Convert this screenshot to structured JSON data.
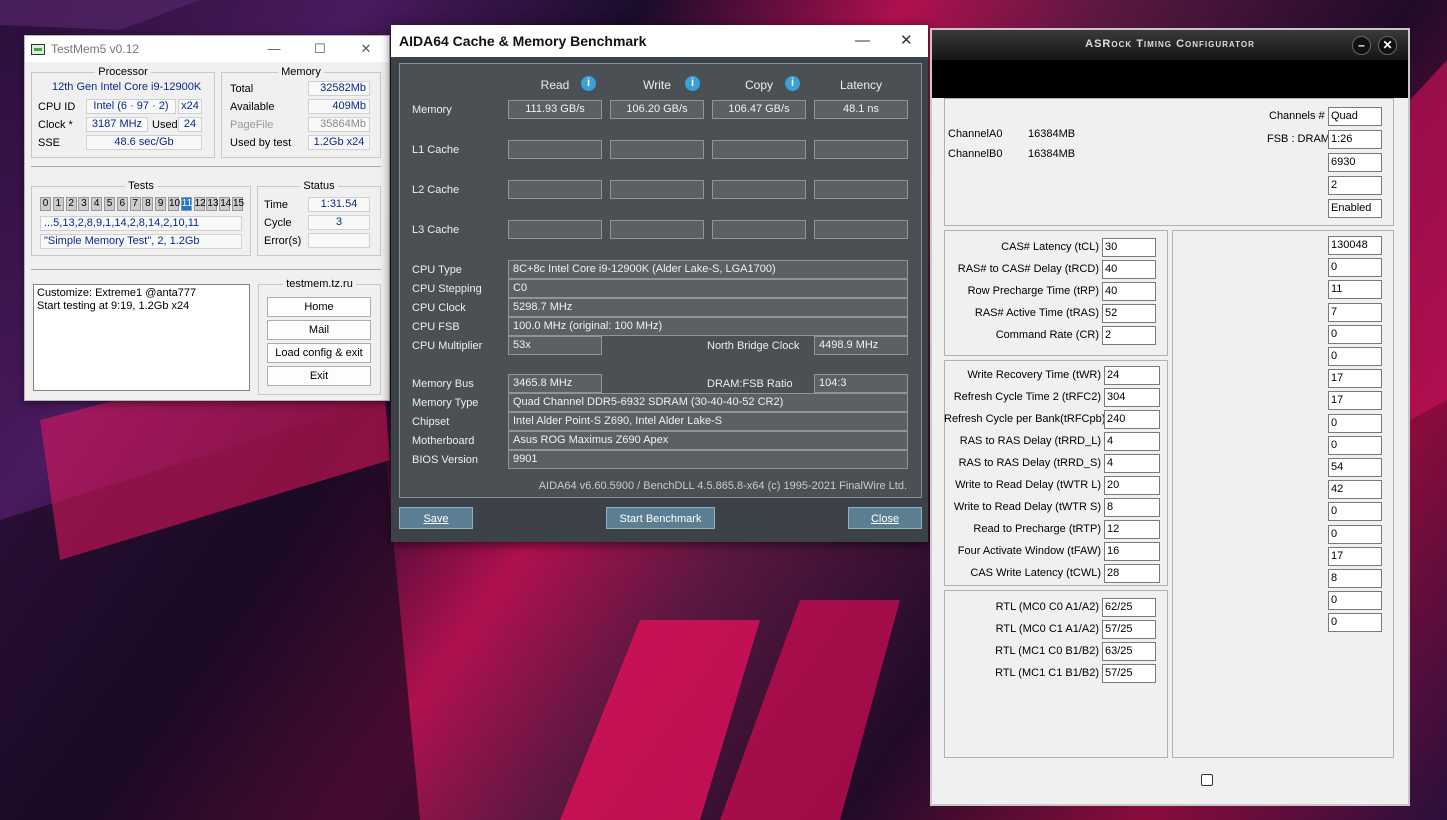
{
  "testmem": {
    "title": "TestMem5 v0.12",
    "processor": {
      "heading": "Processor",
      "name": "12th Gen Intel Core i9-12900K",
      "cpuid_label": "CPU ID",
      "cpuid_value": "Intel  (6 · 97 · 2)",
      "threads": "x24",
      "clock_label": "Clock *",
      "clock_value": "3187 MHz",
      "used_label": "Used",
      "used_value": "24",
      "sse_label": "SSE",
      "sse_value": "48.6 sec/Gb"
    },
    "memory": {
      "heading": "Memory",
      "total_label": "Total",
      "total_value": "32582Mb",
      "available_label": "Available",
      "available_value": "409Mb",
      "pagefile_label": "PageFile",
      "pagefile_value": "35864Mb",
      "usedby_label": "Used by test",
      "usedby_value": "1.2Gb x24"
    },
    "tests": {
      "heading": "Tests",
      "numbers": [
        "0",
        "1",
        "2",
        "3",
        "4",
        "5",
        "6",
        "7",
        "8",
        "9",
        "10",
        "11",
        "12",
        "13",
        "14",
        "15"
      ],
      "active": "11",
      "sequence": "...5,13,2,8,9,1,14,2,8,14,2,10,11",
      "current": "\"Simple Memory Test\", 2, 1.2Gb"
    },
    "status": {
      "heading": "Status",
      "time_label": "Time",
      "time_value": "1:31.54",
      "cycle_label": "Cycle",
      "cycle_value": "3",
      "errors_label": "Error(s)",
      "errors_value": ""
    },
    "log": {
      "line1": "Customize: Extreme1 @anta777",
      "line2": "Start testing at 9:19, 1.2Gb x24"
    },
    "site": {
      "heading": "testmem.tz.ru",
      "home": "Home",
      "mail": "Mail",
      "load": "Load config & exit",
      "exit": "Exit"
    }
  },
  "aida": {
    "title": "AIDA64 Cache & Memory Benchmark",
    "headers": {
      "read": "Read",
      "write": "Write",
      "copy": "Copy",
      "latency": "Latency"
    },
    "rows": {
      "memory": {
        "label": "Memory",
        "read": "111.93 GB/s",
        "write": "106.20 GB/s",
        "copy": "106.47 GB/s",
        "latency": "48.1 ns"
      },
      "l1": {
        "label": "L1 Cache"
      },
      "l2": {
        "label": "L2 Cache"
      },
      "l3": {
        "label": "L3 Cache"
      }
    },
    "info": {
      "cpu_type_label": "CPU Type",
      "cpu_type": "8C+8c Intel Core i9-12900K  (Alder Lake-S, LGA1700)",
      "cpu_stepping_label": "CPU Stepping",
      "cpu_stepping": "C0",
      "cpu_clock_label": "CPU Clock",
      "cpu_clock": "5298.7 MHz",
      "cpu_fsb_label": "CPU FSB",
      "cpu_fsb": "100.0 MHz  (original: 100 MHz)",
      "cpu_mult_label": "CPU Multiplier",
      "cpu_mult": "53x",
      "nb_clock_label": "North Bridge Clock",
      "nb_clock": "4498.9 MHz",
      "mem_bus_label": "Memory Bus",
      "mem_bus": "3465.8 MHz",
      "dram_fsb_label": "DRAM:FSB Ratio",
      "dram_fsb": "104:3",
      "mem_type_label": "Memory Type",
      "mem_type": "Quad Channel DDR5-6932 SDRAM  (30-40-40-52 CR2)",
      "chipset_label": "Chipset",
      "chipset": "Intel Alder Point-S Z690, Intel Alder Lake-S",
      "mobo_label": "Motherboard",
      "mobo": "Asus ROG Maximus Z690 Apex",
      "bios_label": "BIOS Version",
      "bios": "9901"
    },
    "footer": "AIDA64 v6.60.5900 / BenchDLL 4.5.865.8-x64  (c) 1995-2021 FinalWire Ltd.",
    "buttons": {
      "save": "Save",
      "start": "Start Benchmark",
      "close": "Close"
    }
  },
  "asrock": {
    "title": "ASRock Timing Configurator",
    "channels": [
      {
        "name": "ChannelA0",
        "size": "16384MB"
      },
      {
        "name": "ChannelB0",
        "size": "16384MB"
      }
    ],
    "channels_label": "Channels #",
    "channels_value": "Quad",
    "fsb_label": "FSB : DRAM",
    "fsb_value": "1:26",
    "freq_value": "6930",
    "val2": "2",
    "enabled_value": "Enabled",
    "primary": [
      {
        "label": "CAS# Latency (tCL)",
        "value": "30"
      },
      {
        "label": "RAS# to CAS# Delay (tRCD)",
        "value": "40"
      },
      {
        "label": "Row Precharge Time (tRP)",
        "value": "40"
      },
      {
        "label": "RAS# Active Time (tRAS)",
        "value": "52"
      },
      {
        "label": "Command Rate (CR)",
        "value": "2"
      }
    ],
    "secondary": [
      {
        "label": "Write Recovery Time (tWR)",
        "value": "24"
      },
      {
        "label": "Refresh Cycle Time 2 (tRFC2)",
        "value": "304"
      },
      {
        "label": "Refresh Cycle per Bank(tRFCpb)",
        "value": "240"
      },
      {
        "label": "RAS to RAS Delay (tRRD_L)",
        "value": "4"
      },
      {
        "label": "RAS to RAS Delay (tRRD_S)",
        "value": "4"
      },
      {
        "label": "Write to Read Delay (tWTR  L)",
        "value": "20"
      },
      {
        "label": "Write to Read Delay (tWTR  S)",
        "value": "8"
      },
      {
        "label": "Read to Precharge (tRTP)",
        "value": "12"
      },
      {
        "label": "Four Activate Window (tFAW)",
        "value": "16"
      },
      {
        "label": "CAS Write Latency (tCWL)",
        "value": "28"
      }
    ],
    "rtl": [
      {
        "label": "RTL (MC0 C0 A1/A2)",
        "value": "62/25"
      },
      {
        "label": "RTL (MC0 C1 A1/A2)",
        "value": "57/25"
      },
      {
        "label": "RTL (MC1 C0 B1/B2)",
        "value": "63/25"
      },
      {
        "label": "RTL (MC1 C1 B1/B2)",
        "value": "57/25"
      }
    ],
    "right_values": [
      "130048",
      "0",
      "11",
      "7",
      "0",
      "0",
      "17",
      "17",
      "0",
      "0",
      "54",
      "42",
      "0",
      "0",
      "17",
      "8",
      "0",
      "0"
    ]
  }
}
